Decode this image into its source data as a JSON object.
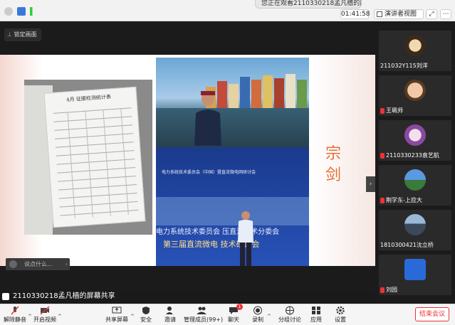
{
  "topbar": {
    "viewing_text": "您正在观看2110330218孟凡樯的屏幕",
    "timer": "01:41:58",
    "view_mode": "演讲者视图"
  },
  "stage": {
    "lock_label": "锁定画面",
    "chat_placeholder": "说点什么...",
    "slide": {
      "sheet_title": "4月  征服检测统计表",
      "banner_line1": "电力系统技术委员会（中国）暨直流微电网研讨会",
      "banner_line2": "电力系统技术委员会  压直流技术分委会",
      "banner_line3": "第三届直流微电  技术研讨会",
      "side_title": "宗剑"
    },
    "share_label": "2110330218孟凡樯的屏幕共享"
  },
  "participants": [
    {
      "name": "211032Y115刘洋"
    },
    {
      "name": "王珮师"
    },
    {
      "name": "2110330233袁艺航"
    },
    {
      "name": "荆学东-上应大"
    },
    {
      "name": "1810300421沈立桥"
    },
    {
      "name": "刘园"
    }
  ],
  "toolbar": {
    "mute": "解除静音",
    "video": "开启视频",
    "share": "共享屏幕",
    "security": "安全",
    "invite": "邀请",
    "members": "管理成员(99+)",
    "chat": "聊天",
    "chat_badge": "1",
    "record": "录制",
    "breakout": "分组讨论",
    "apps": "应用",
    "settings": "设置",
    "end": "结束会议"
  },
  "colors": {
    "accent_red": "#e33333",
    "title_orange": "#e76f35"
  }
}
